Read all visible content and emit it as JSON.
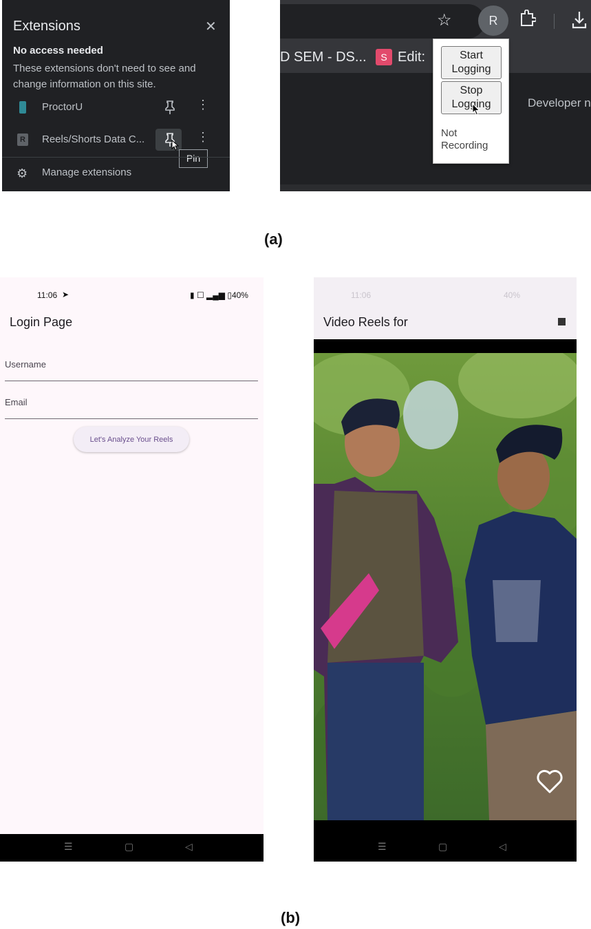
{
  "panel_a": {
    "extensions": {
      "title": "Extensions",
      "close_glyph": "✕",
      "section_title": "No access needed",
      "section_desc": "These extensions don't need to see and change information on this site.",
      "items": [
        {
          "name": "ProctorU",
          "icon": "proctoru-icon"
        },
        {
          "name": "Reels/Shorts Data C...",
          "icon": "reels-extension-icon",
          "icon_letter": "R"
        }
      ],
      "pin_tooltip": "Pin",
      "more_glyph": "⋮",
      "manage_label": "Manage extensions"
    },
    "browser": {
      "avatar_letter": "R",
      "bookmark_1": "D SEM - DS...",
      "bookmark_2": "Edit:",
      "bookmark_2_icon_letter": "S",
      "popup": {
        "start_label": "Start Logging",
        "stop_label": "Stop Logging",
        "status": "Not Recording"
      },
      "developer_label": "Developer n"
    },
    "caption": "(a)"
  },
  "panel_b": {
    "login_screen": {
      "status_time": "11:06",
      "status_battery": "40%",
      "title": "Login Page",
      "username_placeholder": "Username",
      "email_placeholder": "Email",
      "button_label": "Let's Analyze Your Reels"
    },
    "reels_screen": {
      "status_time": "11:06",
      "status_battery": "40%",
      "title": "Video Reels for",
      "heart_icon": "heart-outline-icon"
    },
    "nav_glyphs": {
      "menu": "☰",
      "home": "▢",
      "back": "◁"
    },
    "caption": "(b)"
  },
  "colors": {
    "dark_panel": "#202124",
    "toolbar": "#35363a",
    "login_bg": "#fef7fb",
    "button_text": "#6a4f8d",
    "bookmark_icon": "#e24a6c"
  }
}
